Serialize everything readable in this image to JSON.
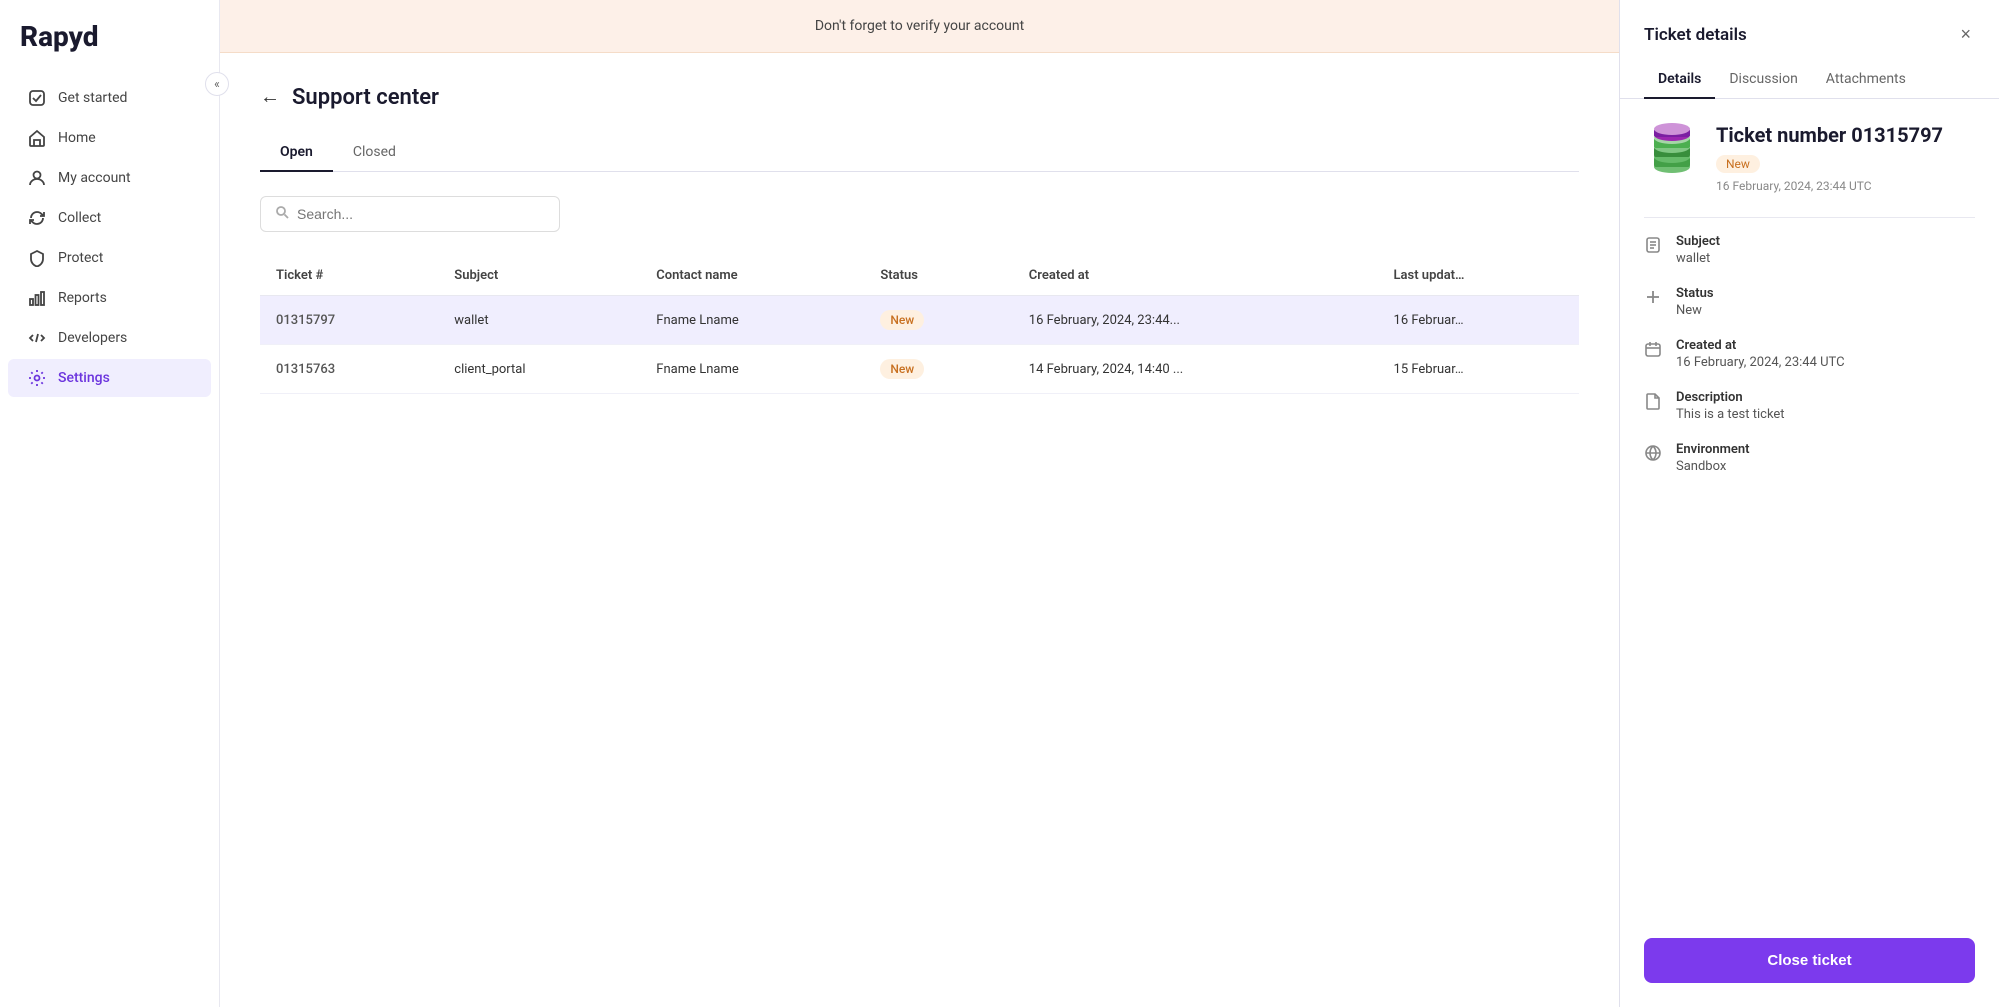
{
  "app": {
    "logo": "Rapyd"
  },
  "sidebar": {
    "collapse_label": "«",
    "items": [
      {
        "id": "get-started",
        "label": "Get started",
        "icon": "checkbox-icon"
      },
      {
        "id": "home",
        "label": "Home",
        "icon": "home-icon"
      },
      {
        "id": "my-account",
        "label": "My account",
        "icon": "user-icon"
      },
      {
        "id": "collect",
        "label": "Collect",
        "icon": "refresh-icon"
      },
      {
        "id": "protect",
        "label": "Protect",
        "icon": "shield-icon"
      },
      {
        "id": "reports",
        "label": "Reports",
        "icon": "bar-chart-icon"
      },
      {
        "id": "developers",
        "label": "Developers",
        "icon": "code-icon"
      },
      {
        "id": "settings",
        "label": "Settings",
        "icon": "gear-icon",
        "active": true
      }
    ]
  },
  "banner": {
    "text": "Don't forget to verify your account"
  },
  "page": {
    "title": "Support center",
    "back_label": "←",
    "tabs": [
      {
        "id": "open",
        "label": "Open",
        "active": true
      },
      {
        "id": "closed",
        "label": "Closed"
      }
    ],
    "search_placeholder": "Search...",
    "table": {
      "headers": [
        "Ticket #",
        "Subject",
        "Contact name",
        "Status",
        "Created at",
        "Last updat…"
      ],
      "rows": [
        {
          "ticket_num": "01315797",
          "subject": "wallet",
          "contact_name": "Fname Lname",
          "status": "New",
          "created_at": "16 February, 2024, 23:44...",
          "last_updated": "16 Februar…",
          "selected": true
        },
        {
          "ticket_num": "01315763",
          "subject": "client_portal",
          "contact_name": "Fname Lname",
          "status": "New",
          "created_at": "14 February, 2024, 14:40 ...",
          "last_updated": "15 Februar…",
          "selected": false
        }
      ]
    }
  },
  "ticket_panel": {
    "title": "Ticket details",
    "close_icon": "×",
    "tabs": [
      {
        "id": "details",
        "label": "Details",
        "active": true
      },
      {
        "id": "discussion",
        "label": "Discussion"
      },
      {
        "id": "attachments",
        "label": "Attachments"
      }
    ],
    "ticket": {
      "number": "Ticket number 01315797",
      "status": "New",
      "date": "16 February, 2024, 23:44 UTC",
      "fields": [
        {
          "id": "subject",
          "label": "Subject",
          "value": "wallet",
          "icon": "document-icon"
        },
        {
          "id": "status",
          "label": "Status",
          "value": "New",
          "icon": "plus-icon"
        },
        {
          "id": "created-at",
          "label": "Created at",
          "value": "16 February, 2024, 23:44 UTC",
          "icon": "calendar-icon"
        },
        {
          "id": "description",
          "label": "Description",
          "value": "This is a test ticket",
          "icon": "file-icon"
        },
        {
          "id": "environment",
          "label": "Environment",
          "value": "Sandbox",
          "icon": "globe-icon"
        }
      ]
    },
    "close_button_label": "Close ticket"
  }
}
